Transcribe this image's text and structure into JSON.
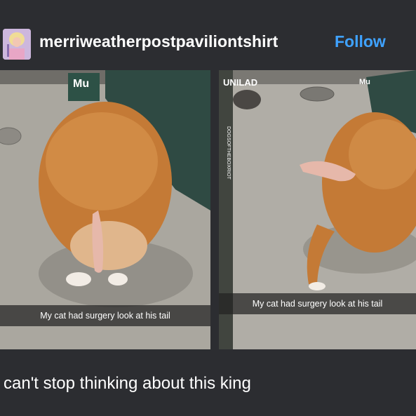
{
  "post": {
    "username": "merriweatherpostpaviliontshirt",
    "follow_label": "Follow",
    "body_text": "can't stop thinking about this king"
  },
  "images": [
    {
      "caption": "My cat had surgery look at his tail",
      "overlay_text": "Mu"
    },
    {
      "caption": "My cat had surgery look at his tail",
      "watermark": "UNILAD",
      "side_text": "DOGSOFTHEBOXRIOT",
      "overlay_text": "Mu"
    }
  ],
  "colors": {
    "background": "#2c2d31",
    "accent": "#3fa2ff",
    "text": "#ffffff"
  }
}
